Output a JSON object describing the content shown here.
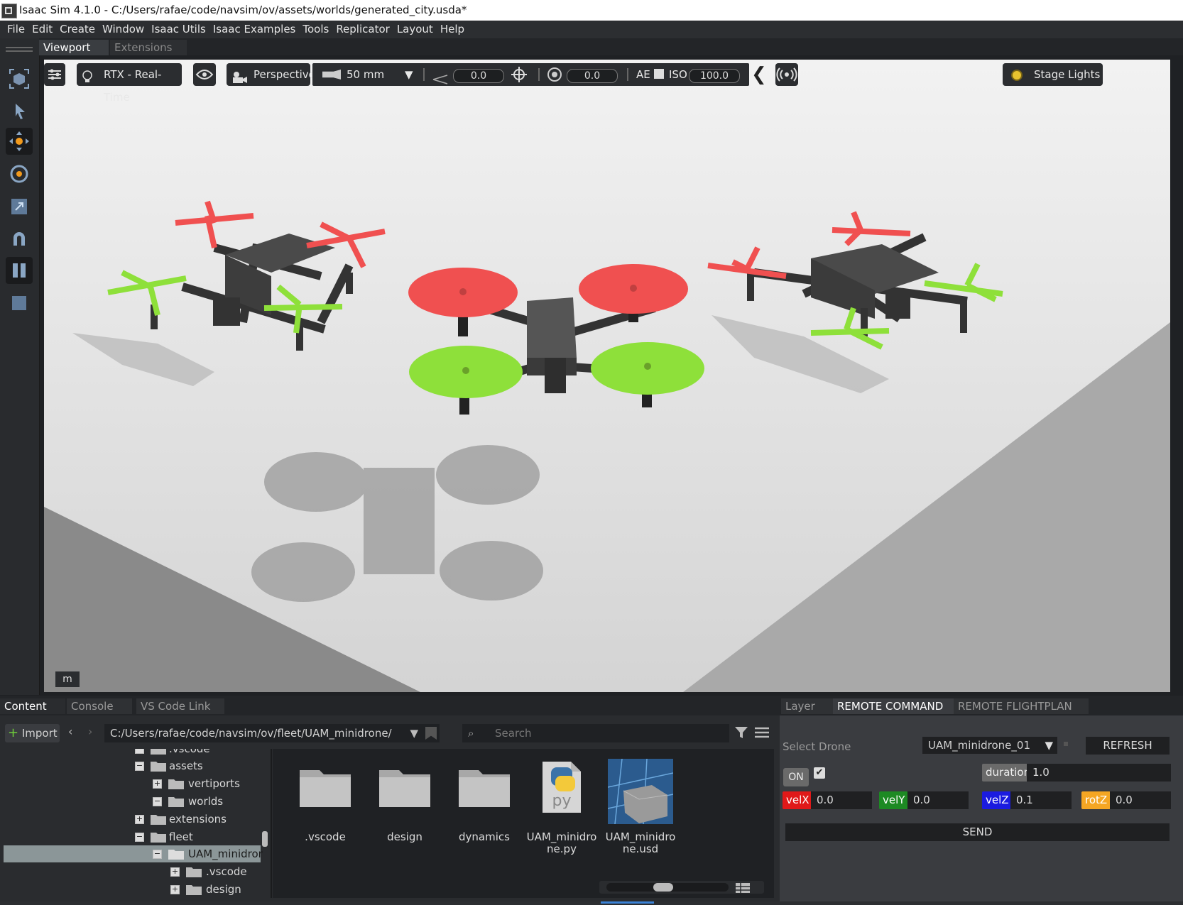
{
  "window": {
    "title": "Isaac Sim 4.1.0 - C:/Users/rafae/code/navsim/ov/assets/worlds/generated_city.usda*"
  },
  "menu": [
    "File",
    "Edit",
    "Create",
    "Window",
    "Isaac Utils",
    "Isaac Examples",
    "Tools",
    "Replicator",
    "Layout",
    "Help"
  ],
  "viewport_tabs": {
    "viewport": "Viewport",
    "extensions": "Extensions"
  },
  "viewport_toolbar": {
    "renderer": "RTX - Real-Time",
    "camera": "Perspective",
    "lens": "50 mm",
    "focus_value": "0.0",
    "fstop_value": "0.0",
    "ae_label": "AE",
    "iso_label": "ISO",
    "iso_value": "100.0",
    "stage_lights": "Stage Lights"
  },
  "viewport_unit": "m",
  "bottom_tabs": {
    "content": "Content",
    "console": "Console",
    "vscode": "VS Code Link"
  },
  "content": {
    "import_label": "Import",
    "path": "C:/Users/rafae/code/navsim/ov/fleet/UAM_minidrone/",
    "search_placeholder": "Search",
    "tree": [
      {
        "label": ".vscode"
      },
      {
        "label": "assets"
      },
      {
        "label": "vertiports"
      },
      {
        "label": "worlds"
      },
      {
        "label": "extensions"
      },
      {
        "label": "fleet"
      },
      {
        "label": "UAM_minidrone"
      },
      {
        "label": ".vscode"
      },
      {
        "label": "design"
      }
    ],
    "files": [
      {
        "name": ".vscode",
        "line2": ""
      },
      {
        "name": "design",
        "line2": ""
      },
      {
        "name": "dynamics",
        "line2": ""
      },
      {
        "name": "UAM_minidro",
        "line2": "ne.py"
      },
      {
        "name": "UAM_minidro",
        "line2": "ne.usd"
      }
    ]
  },
  "right_tabs": {
    "layer": "Layer",
    "remote_command": "REMOTE COMMAND",
    "remote_flightplan": "REMOTE FLIGHTPLAN"
  },
  "remote": {
    "select_drone_label": "Select Drone",
    "selected_drone": "UAM_minidrone_01",
    "refresh_label": "REFRESH",
    "on_label": "ON",
    "duration_label": "duration",
    "duration_value": "1.0",
    "velx_label": "velX",
    "velx_value": "0.0",
    "vely_label": "velY",
    "vely_value": "0.0",
    "velz_label": "velZ",
    "velz_value": "0.1",
    "rotz_label": "rotZ",
    "rotz_value": "0.0",
    "send_label": "SEND"
  },
  "colors": {
    "red": "#f05050",
    "green": "#8ee03a",
    "velx": "#e01919",
    "vely": "#1d8a23",
    "velz": "#1b1be0",
    "rotz": "#f5a623"
  }
}
